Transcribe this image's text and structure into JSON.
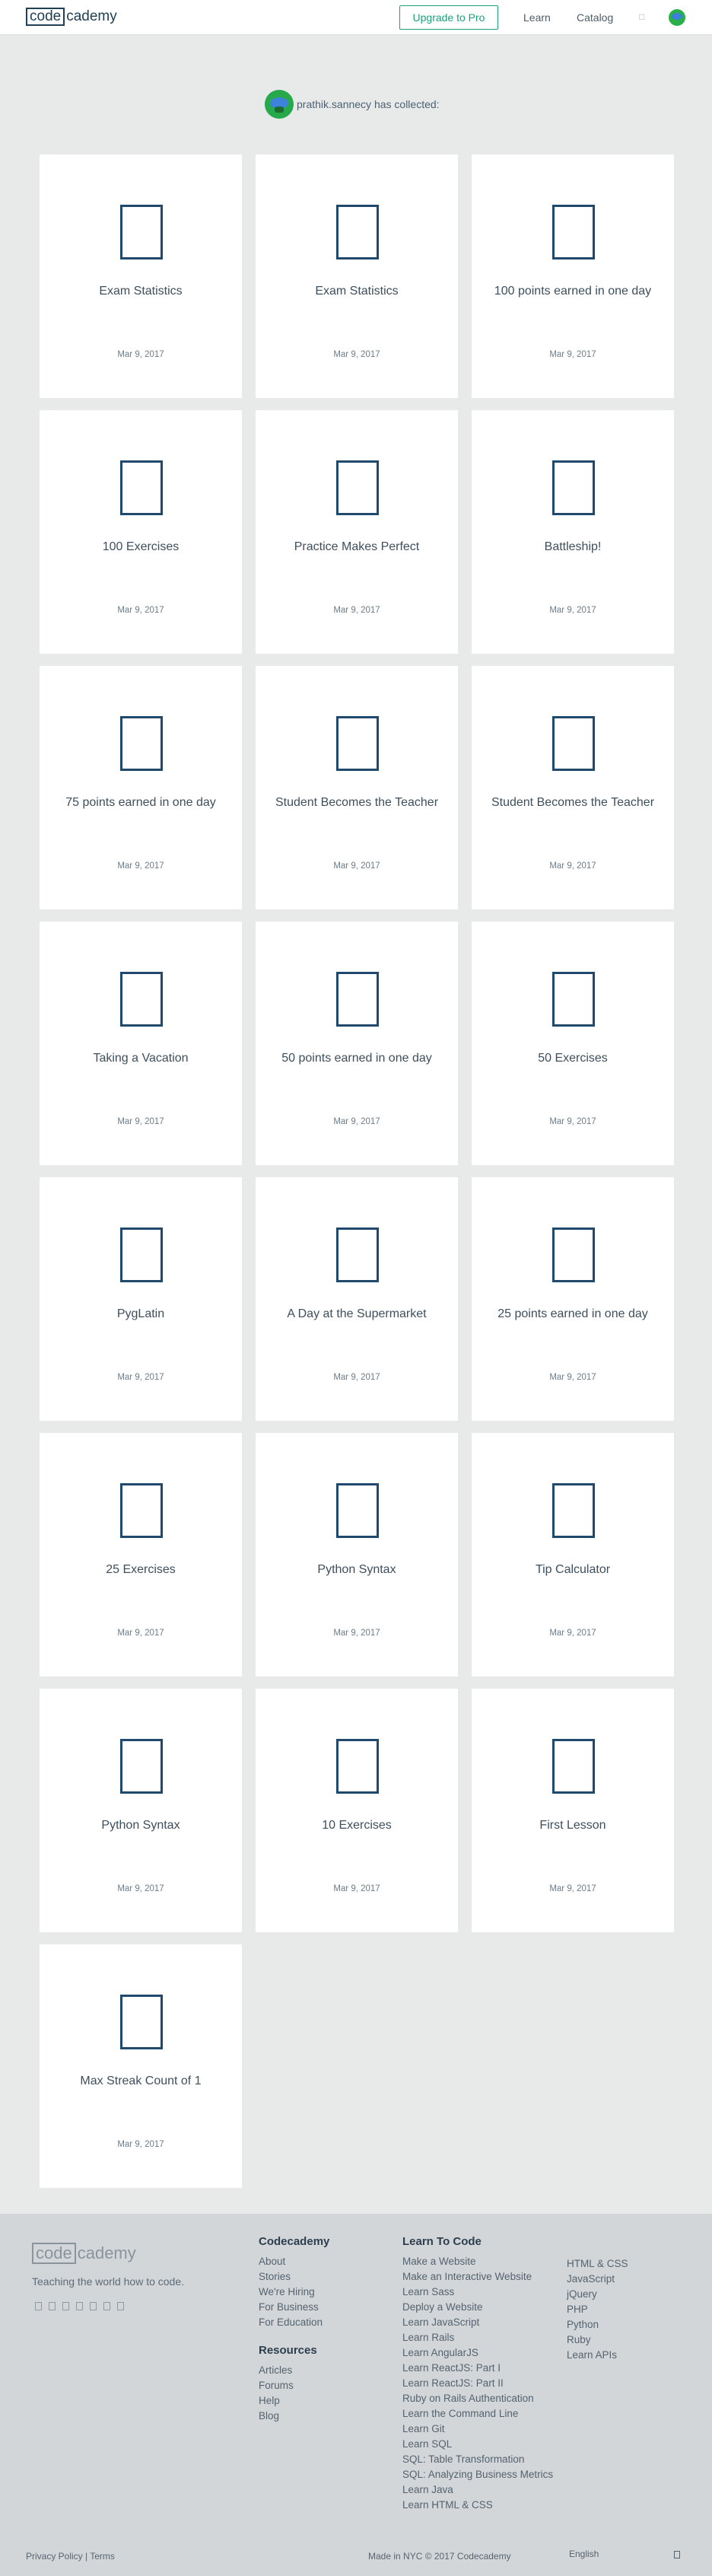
{
  "header": {
    "logo_code": "code",
    "logo_rest": "cademy",
    "upgrade_label": "Upgrade to Pro",
    "learn_label": "Learn",
    "catalog_label": "Catalog",
    "notification_icon": "notification-icon"
  },
  "collector": {
    "text": "prathik.sannecy has collected:"
  },
  "badges": [
    {
      "name": "Exam Statistics",
      "date": "Mar 9, 2017"
    },
    {
      "name": "Exam Statistics",
      "date": "Mar 9, 2017"
    },
    {
      "name": "100 points earned in one day",
      "date": "Mar 9, 2017"
    },
    {
      "name": "100 Exercises",
      "date": "Mar 9, 2017"
    },
    {
      "name": "Practice Makes Perfect",
      "date": "Mar 9, 2017"
    },
    {
      "name": "Battleship!",
      "date": "Mar 9, 2017"
    },
    {
      "name": "75 points earned in one day",
      "date": "Mar 9, 2017"
    },
    {
      "name": "Student Becomes the Teacher",
      "date": "Mar 9, 2017"
    },
    {
      "name": "Student Becomes the Teacher",
      "date": "Mar 9, 2017"
    },
    {
      "name": "Taking a Vacation",
      "date": "Mar 9, 2017"
    },
    {
      "name": "50 points earned in one day",
      "date": "Mar 9, 2017"
    },
    {
      "name": "50 Exercises",
      "date": "Mar 9, 2017"
    },
    {
      "name": "PygLatin",
      "date": "Mar 9, 2017"
    },
    {
      "name": "A Day at the Supermarket",
      "date": "Mar 9, 2017"
    },
    {
      "name": "25 points earned in one day",
      "date": "Mar 9, 2017"
    },
    {
      "name": "25 Exercises",
      "date": "Mar 9, 2017"
    },
    {
      "name": "Python Syntax",
      "date": "Mar 9, 2017"
    },
    {
      "name": "Tip Calculator",
      "date": "Mar 9, 2017"
    },
    {
      "name": "Python Syntax",
      "date": "Mar 9, 2017"
    },
    {
      "name": "10 Exercises",
      "date": "Mar 9, 2017"
    },
    {
      "name": "First Lesson",
      "date": "Mar 9, 2017"
    },
    {
      "name": "Max Streak Count of 1",
      "date": "Mar 9, 2017"
    }
  ],
  "footer": {
    "logo_code": "code",
    "logo_rest": "cademy",
    "tagline": "Teaching the world how to code.",
    "company_heading": "Codecademy",
    "company_links": [
      "About",
      "Stories",
      "We're Hiring",
      "For Business",
      "For Education"
    ],
    "resources_heading": "Resources",
    "resources_links": [
      "Articles",
      "Forums",
      "Help",
      "Blog"
    ],
    "learn_heading": "Learn To Code",
    "learn_links": [
      "Make a Website",
      "Make an Interactive Website",
      "Learn Sass",
      "Deploy a Website",
      "Learn JavaScript",
      "Learn Rails",
      "Learn AngularJS",
      "Learn ReactJS: Part I",
      "Learn ReactJS: Part II",
      "Ruby on Rails Authentication",
      "Learn the Command Line",
      "Learn Git",
      "Learn SQL",
      "SQL: Table Transformation",
      "SQL: Analyzing Business Metrics",
      "Learn Java",
      "Learn HTML & CSS"
    ],
    "lang_links": [
      "HTML & CSS",
      "JavaScript",
      "jQuery",
      "PHP",
      "Python",
      "Ruby",
      "Learn APIs"
    ],
    "bottom_links": "Privacy Policy | Terms",
    "made_in": "Made in NYC © 2017 Codecademy",
    "language": "English"
  }
}
